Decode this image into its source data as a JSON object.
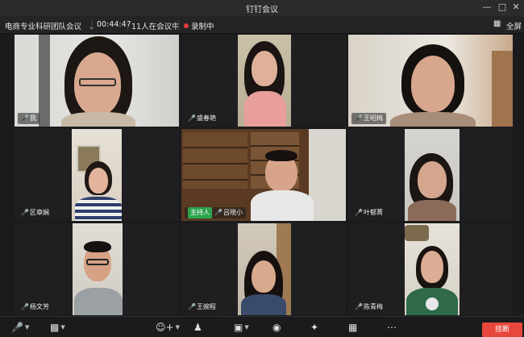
{
  "window": {
    "title": "钉钉会议",
    "minimize_icon": "minimize-icon",
    "maximize_icon": "maximize-icon",
    "close_icon": "close-icon"
  },
  "infobar": {
    "meeting_name": "电商专业科研团队会议",
    "duration": "00:44:47",
    "participants": "11人在会议中",
    "recording": "录制中",
    "fullscreen": "全屏",
    "recording_color": "#e23b3b"
  },
  "tiles": [
    {
      "name": "我",
      "mic": "mic-icon"
    },
    {
      "name": "盛春艳",
      "mic": "mic-icon"
    },
    {
      "name": "王昭梅",
      "mic": "mic-icon"
    },
    {
      "name": "区章娴",
      "mic": "mic-icon"
    },
    {
      "name": "吕晓小",
      "host": "主持人",
      "mic": "mic-icon"
    },
    {
      "name": "叶郁菁",
      "mic": "mic-icon"
    },
    {
      "name": "杨文芳",
      "mic": "mic-icon"
    },
    {
      "name": "王婉程",
      "mic": "mic-icon"
    },
    {
      "name": "陈青梅",
      "mic": "mic-icon"
    }
  ],
  "toolbar": {
    "hangup": "挂断",
    "hangup_color": "#e8473c",
    "host_color": "#2da44e"
  }
}
